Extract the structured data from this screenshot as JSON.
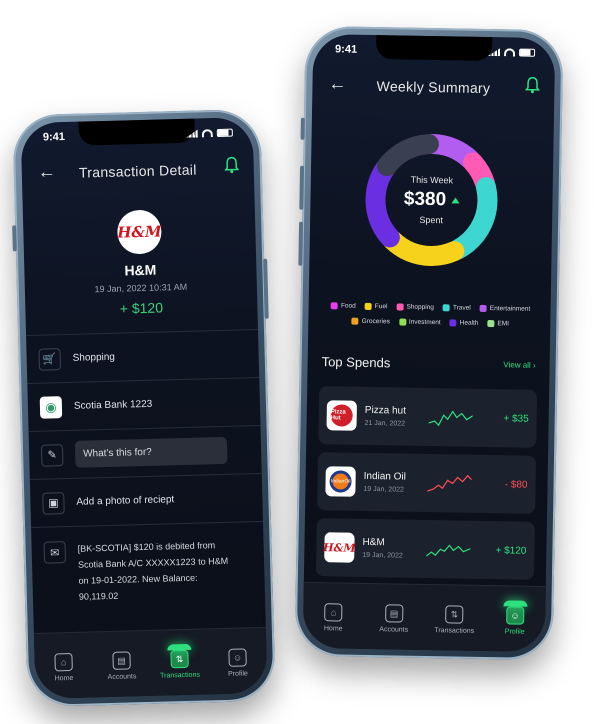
{
  "colors": {
    "accent_green": "#2ee07e",
    "negative_red": "#ff4b55",
    "background": "#0d1220"
  },
  "left_phone": {
    "status_time": "9:41",
    "title": "Transaction Detail",
    "merchant_logo": "H&M",
    "merchant": "H&M",
    "datetime": "19 Jan, 2022 10:31 AM",
    "amount": "+ $120",
    "rows": {
      "category": "Shopping",
      "bank": "Scotia Bank 1223",
      "note_placeholder": "What's this for?",
      "photo": "Add a photo of reciept",
      "message": "[BK-SCOTIA] $120 is debited from Scotia Bank A/C XXXXX1223 to H&M on 19-01-2022. New Balance: 90,119.02"
    },
    "tabs": [
      "Home",
      "Accounts",
      "Transactions",
      "Profile"
    ],
    "active_tab": "Transactions"
  },
  "right_phone": {
    "status_time": "9:41",
    "title": "Weekly Summary",
    "donut": {
      "label": "This Week",
      "value": "$380",
      "sub": "Spent",
      "segments": [
        {
          "name": "Entertainment",
          "fraction": 0.13,
          "color": "#b35cf0"
        },
        {
          "name": "Shopping",
          "fraction": 0.08,
          "color": "#ff5ab4"
        },
        {
          "name": "Travel",
          "fraction": 0.22,
          "color": "#3ed6d0"
        },
        {
          "name": "Fuel",
          "fraction": 0.2,
          "color": "#f6d21c"
        },
        {
          "name": "Health",
          "fraction": 0.22,
          "color": "#6a2fe0"
        },
        {
          "name": "Groceries",
          "fraction": 0.15,
          "color": "#3a3f52"
        }
      ]
    },
    "legend": [
      {
        "label": "Food",
        "color": "#e93cf0"
      },
      {
        "label": "Fuel",
        "color": "#f6d21c"
      },
      {
        "label": "Shopping",
        "color": "#ff5ab4"
      },
      {
        "label": "Travel",
        "color": "#3ed6d0"
      },
      {
        "label": "Entertainment",
        "color": "#b35cf0"
      },
      {
        "label": "Groceries",
        "color": "#f0a020"
      },
      {
        "label": "Investment",
        "color": "#8fe050"
      },
      {
        "label": "Health",
        "color": "#6a2fe0"
      },
      {
        "label": "EMI",
        "color": "#9be38a"
      }
    ],
    "top_spends_title": "Top Spends",
    "view_all": "View all",
    "spends": [
      {
        "name": "Pizza hut",
        "date": "21 Jan, 2022",
        "amount": "+ $35",
        "logo": "Pizza Hut",
        "trend": "positive"
      },
      {
        "name": "Indian Oil",
        "date": "19 Jan, 2022",
        "amount": "- $80",
        "logo": "IndianOil",
        "trend": "negative"
      },
      {
        "name": "H&M",
        "date": "19 Jan, 2022",
        "amount": "+ $120",
        "logo": "H&M",
        "trend": "positive"
      }
    ],
    "tabs": [
      "Home",
      "Accounts",
      "Transactions",
      "Profile"
    ],
    "active_tab": "Profile"
  }
}
